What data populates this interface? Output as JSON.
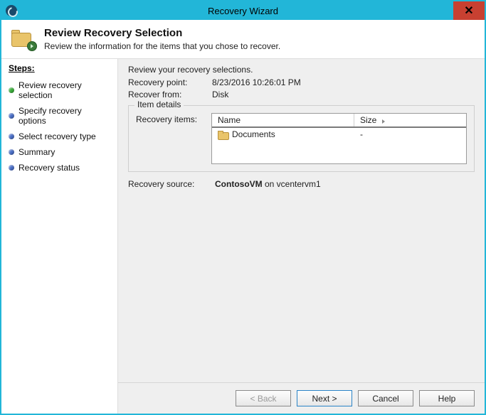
{
  "window": {
    "title": "Recovery Wizard"
  },
  "header": {
    "title": "Review Recovery Selection",
    "subtitle": "Review the information for the items that you chose to recover."
  },
  "sidebar": {
    "title": "Steps:",
    "items": [
      {
        "label": "Review recovery selection",
        "current": true
      },
      {
        "label": "Specify recovery options",
        "current": false
      },
      {
        "label": "Select recovery type",
        "current": false
      },
      {
        "label": "Summary",
        "current": false
      },
      {
        "label": "Recovery status",
        "current": false
      }
    ]
  },
  "main": {
    "intro": "Review your recovery selections.",
    "recovery_point_label": "Recovery point:",
    "recovery_point_value": "8/23/2016 10:26:01 PM",
    "recover_from_label": "Recover from:",
    "recover_from_value": "Disk",
    "item_details_legend": "Item details",
    "recovery_items_label": "Recovery items:",
    "columns": {
      "name": "Name",
      "size": "Size"
    },
    "rows": [
      {
        "name": "Documents",
        "size": "-"
      }
    ],
    "recovery_source_label": "Recovery source:",
    "recovery_source_vm": "ContosoVM",
    "recovery_source_suffix": " on vcentervm1"
  },
  "footer": {
    "back": "< Back",
    "next": "Next >",
    "cancel": "Cancel",
    "help": "Help"
  }
}
